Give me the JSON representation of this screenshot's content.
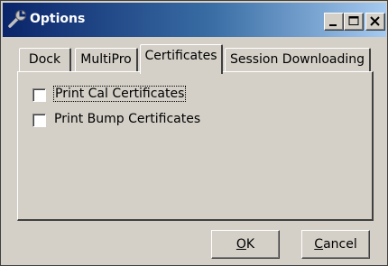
{
  "window": {
    "title": "Options",
    "icon": "wrench-icon"
  },
  "titlebar_buttons": [
    "minimize",
    "maximize",
    "close"
  ],
  "tabs": [
    {
      "label": "Dock",
      "active": false
    },
    {
      "label": "MultiPro",
      "active": false
    },
    {
      "label": "Certificates",
      "active": true
    },
    {
      "label": "Session Downloading",
      "active": false
    }
  ],
  "checkboxes": [
    {
      "label": "Print Cal Certificates",
      "checked": false,
      "focused": true
    },
    {
      "label": "Print Bump Certificates",
      "checked": false,
      "focused": false
    }
  ],
  "buttons": {
    "ok": {
      "accel": "O",
      "rest": "K"
    },
    "cancel": {
      "accel": "C",
      "rest": "ancel"
    }
  }
}
